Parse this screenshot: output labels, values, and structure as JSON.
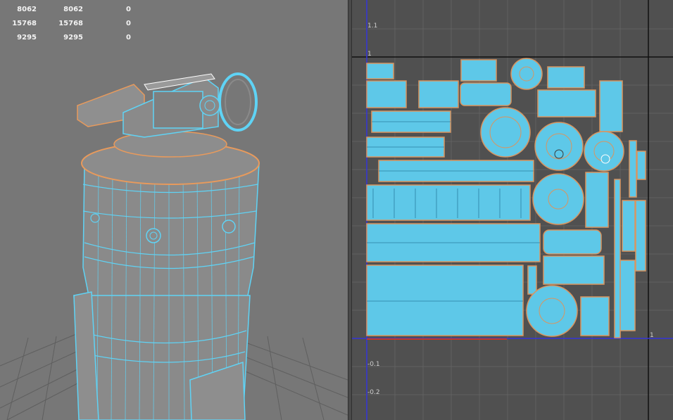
{
  "viewport": {
    "poly_stats": [
      {
        "a": "8062",
        "b": "8062",
        "c": "0"
      },
      {
        "a": "15768",
        "b": "15768",
        "c": "0"
      },
      {
        "a": "9295",
        "b": "9295",
        "c": "0"
      }
    ],
    "colors": {
      "background": "#777777",
      "wire": "#5fd3f5",
      "edge": "#e89a5c",
      "floor_grid": "#5a5a5a"
    }
  },
  "uv_editor": {
    "axis_labels": [
      "1.1",
      "1",
      "-0.1",
      "-0.2",
      "1"
    ],
    "colors": {
      "background": "#505050",
      "grid": "#606060",
      "axis_u": "#3030d0",
      "axis_v": "#1a1a1a",
      "shell_fill": "#5ec8e8",
      "shell_border": "#d99560"
    }
  }
}
